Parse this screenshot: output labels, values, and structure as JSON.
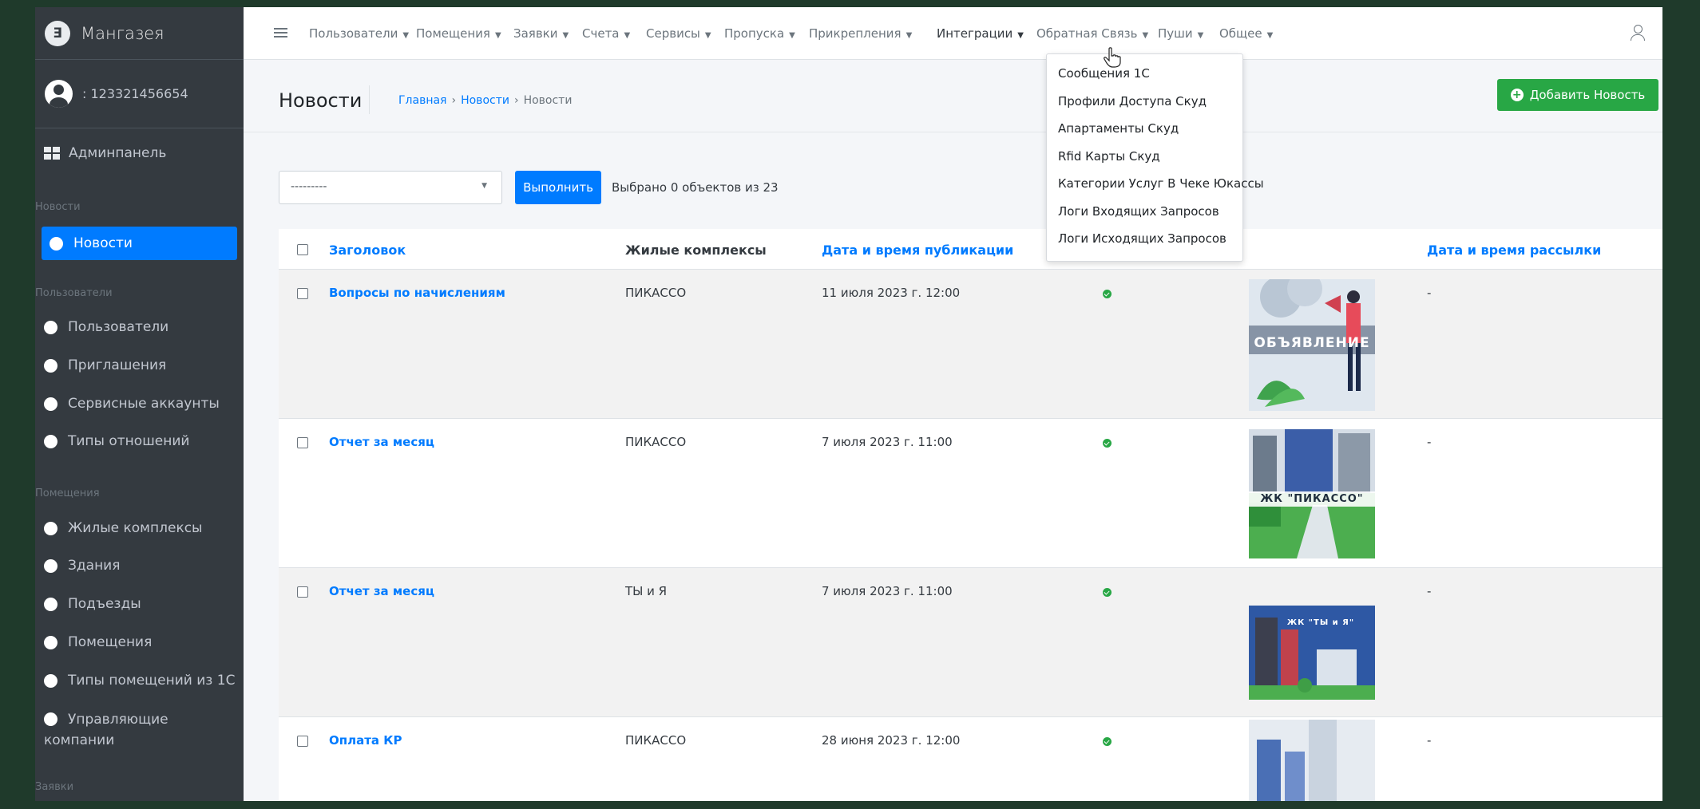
{
  "brand": {
    "name": "Мангазея"
  },
  "user": {
    "name": ": 123321456654"
  },
  "sidebar": {
    "dashboard": "Админпанель",
    "sections": [
      {
        "header": "Новости",
        "items": [
          "Новости"
        ]
      },
      {
        "header": "Пользователи",
        "items": [
          "Пользователи",
          "Приглашения",
          "Сервисные аккаунты",
          "Типы отношений"
        ]
      },
      {
        "header": "Помещения",
        "items": [
          "Жилые комплексы",
          "Здания",
          "Подъезды",
          "Помещения",
          "Типы помещений из 1С",
          "Управляющие компании"
        ]
      },
      {
        "header": "Заявки",
        "items": []
      }
    ]
  },
  "topnav": {
    "menus": [
      "Пользователи",
      "Помещения",
      "Заявки",
      "Счета",
      "Сервисы",
      "Пропуска",
      "Прикрепления",
      "Интеграции",
      "Обратная Связь",
      "Пуши",
      "Общее"
    ],
    "open_menu": "Интеграции",
    "caret": "▼"
  },
  "dropdown": {
    "items": [
      "Сообщения 1С",
      "Профили Доступа Скуд",
      "Апартаменты Скуд",
      "Rfid Карты Скуд",
      "Категории Услуг В Чеке Юкассы",
      "Логи Входящих Запросов",
      "Логи Исходящих Запросов"
    ]
  },
  "page": {
    "title": "Новости",
    "breadcrumb": [
      "Главная",
      "Новости",
      "Новости"
    ],
    "breadcrumb_sep": "›",
    "add_button": "Добавить Новость"
  },
  "actions": {
    "select_value": "---------",
    "run_button": "Выполнить",
    "selected_info": "Выбрано 0 объектов из 23"
  },
  "table": {
    "columns": [
      "Заголовок",
      "Жилые комплексы",
      "Дата и время публикации",
      "Дата и время рассылки"
    ],
    "rows": [
      {
        "title": "Вопросы по начислениям",
        "complex": "ПИКАССО",
        "date": "11 июля 2023 г. 12:00",
        "published": true,
        "mailing": "-",
        "image_label": "ОБЪЯВЛЕНИЕ"
      },
      {
        "title": "Отчет за месяц",
        "complex": "ПИКАССО",
        "date": "7 июля 2023 г. 11:00",
        "published": true,
        "mailing": "-",
        "image_label": "ЖК \"ПИКАССО\""
      },
      {
        "title": "Отчет за месяц",
        "complex": "ТЫ и Я",
        "date": "7 июля 2023 г. 11:00",
        "published": true,
        "mailing": "-",
        "image_label": "ЖК \"ТЫ и Я\""
      },
      {
        "title": "Оплата КР",
        "complex": "ПИКАССО",
        "date": "28 июня 2023 г. 12:00",
        "published": true,
        "mailing": "-",
        "image_label": ""
      }
    ]
  },
  "colors": {
    "sidebar": "#343a40",
    "primary": "#007bff",
    "success": "#28a745",
    "background": "#1f3a2b"
  }
}
